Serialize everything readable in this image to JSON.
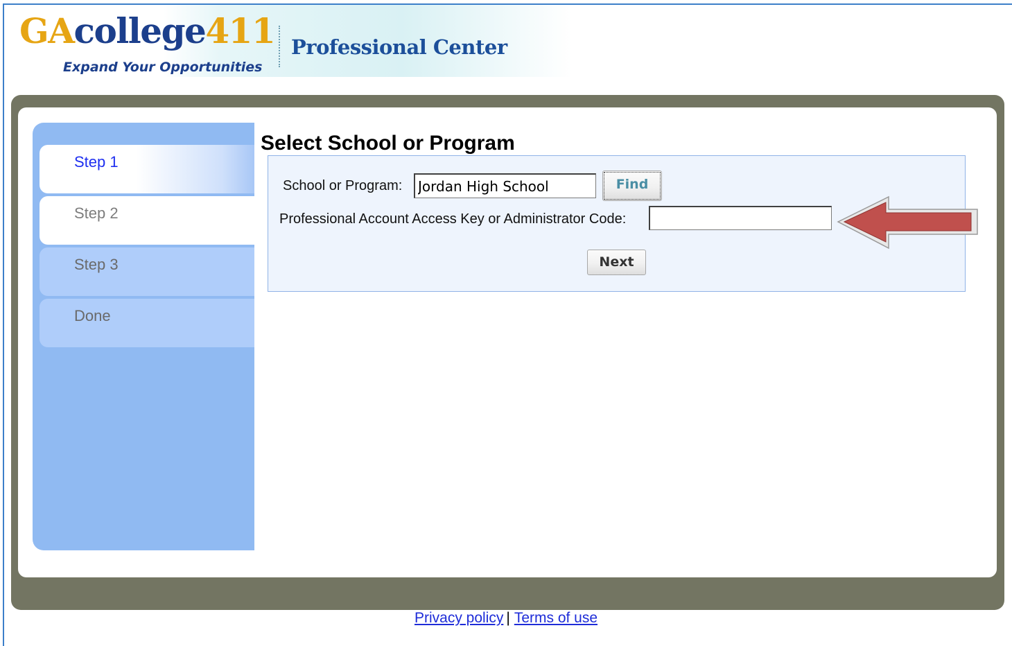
{
  "header": {
    "logo_part1": "GA",
    "logo_part2": "college",
    "logo_part3": "411",
    "tagline": "Expand Your Opportunities",
    "title": "Professional Center"
  },
  "sidebar": {
    "steps": [
      {
        "label": "Step 1",
        "state": "active"
      },
      {
        "label": "Step 2",
        "state": "inactive"
      },
      {
        "label": "Step 3",
        "state": "inactive"
      },
      {
        "label": "Done",
        "state": "inactive"
      }
    ]
  },
  "main": {
    "title": "Select School or Program",
    "school_label": "School or Program:",
    "school_value": "Jordan High School",
    "find_label": "Find",
    "access_key_label": "Professional Account Access Key or Administrator Code:",
    "access_key_value": "",
    "next_label": "Next"
  },
  "annotation": {
    "arrow_icon": "left-arrow-icon",
    "arrow_color": "#c0504d"
  },
  "footer": {
    "privacy_label": "Privacy policy",
    "separator": "|",
    "terms_label": "Terms of use"
  },
  "colors": {
    "brand_gold": "#e6a514",
    "brand_navy": "#1c3f8c",
    "panel_frame": "#737562",
    "sidebar_blue": "#90baf2",
    "link_blue": "#1e2cd8"
  }
}
